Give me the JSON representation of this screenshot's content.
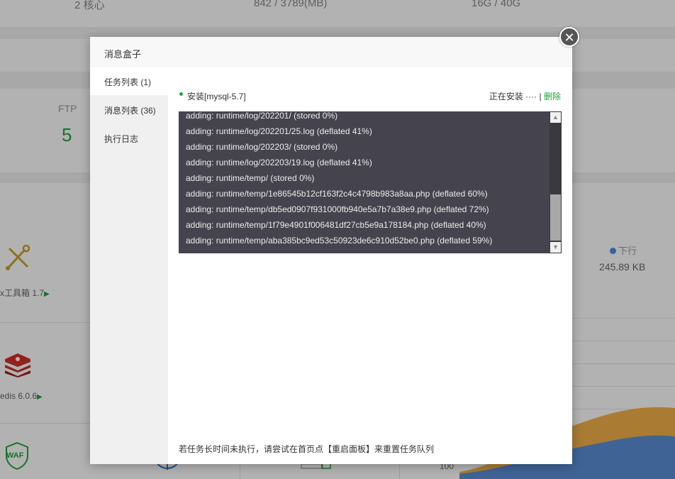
{
  "background": {
    "top_stats": [
      "2 核心",
      "842 / 3789(MB)",
      "16G / 40G"
    ],
    "ftp_label": "FTP",
    "ftp_value": "5",
    "apps": [
      "x工具箱 1.7",
      "edis 6.0.6"
    ],
    "waf_label": "WAF",
    "net_legend": "下行",
    "net_value": "245.89 KB",
    "chart_tick": "100",
    "accent_green": "#20a53a"
  },
  "modal": {
    "title": "消息盒子",
    "close_label": "✕",
    "sidebar": [
      {
        "label": "任务列表 (1)"
      },
      {
        "label": "消息列表 (36)"
      },
      {
        "label": "执行日志"
      }
    ],
    "task": {
      "name": "安装[mysql-5.7]",
      "status": "正在安装 ····",
      "separator": "|",
      "delete_label": "删除"
    },
    "log_lines": [
      "adding: runtime/log/202201/ (stored 0%)",
      "adding: runtime/log/202201/25.log (deflated 41%)",
      "adding: runtime/log/202203/ (stored 0%)",
      "adding: runtime/log/202203/19.log (deflated 41%)",
      "adding: runtime/temp/ (stored 0%)",
      "adding: runtime/temp/1e86545b12cf163f2c4c4798b983a8aa.php (deflated 60%)",
      "adding: runtime/temp/db5ed0907f931000fb940e5a7b7a38e9.php (deflated 72%)",
      "adding: runtime/temp/1f79e4901f006481df27cb5e9a178184.php (deflated 40%)",
      "adding: runtime/temp/aba385bc9ed53c50923de6c910d52be0.php (deflated 59%)"
    ],
    "tip": "若任务长时间未执行，请尝试在首页点【重启面板】来重置任务队列"
  }
}
